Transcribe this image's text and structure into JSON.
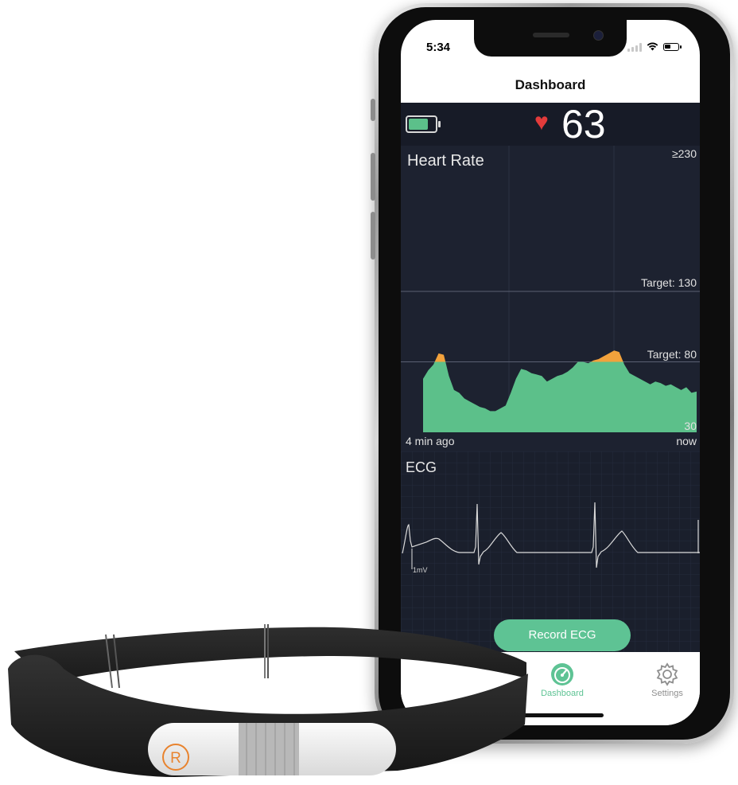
{
  "status_bar": {
    "time": "5:34"
  },
  "nav": {
    "title": "Dashboard"
  },
  "live": {
    "bpm": "63"
  },
  "heart_rate_chart": {
    "title": "Heart Rate",
    "max_label": "≥230",
    "min_label": "30",
    "target_high_label": "Target: 130",
    "target_low_label": "Target: 80",
    "start_label": "4 min ago",
    "end_label": "now",
    "colors": {
      "fill": "#5cc08a",
      "above_target": "#f2a23c",
      "background": "#1d2230"
    }
  },
  "chart_data": {
    "type": "area",
    "title": "Heart Rate",
    "xlabel": "",
    "ylabel": "",
    "x_range": [
      "4 min ago",
      "now"
    ],
    "ylim": [
      30,
      230
    ],
    "reference_lines": [
      130,
      80
    ],
    "series": [
      {
        "values": [
          68,
          74,
          78,
          86,
          85,
          70,
          60,
          58,
          54,
          52,
          50,
          48,
          47,
          45,
          45,
          47,
          49,
          58,
          68,
          75,
          74,
          72,
          71,
          70,
          66,
          68,
          70,
          71,
          73,
          76,
          80,
          80,
          79,
          81,
          82,
          84,
          86,
          88,
          87,
          78,
          72,
          70,
          68,
          66,
          64,
          66,
          65,
          63,
          64,
          62,
          60,
          62,
          58,
          59
        ]
      }
    ]
  },
  "ecg": {
    "title": "ECG",
    "scale_label": "1mV",
    "record_button": "Record ECG"
  },
  "tabs": [
    {
      "label": "Dashboard",
      "icon": "dashboard-gauge-icon",
      "active": true
    },
    {
      "label": "Settings",
      "icon": "gear-icon",
      "active": false
    }
  ],
  "strap": {
    "logo": "R"
  },
  "colors": {
    "accent": "#5ec394",
    "heart": "#e33b3b"
  }
}
